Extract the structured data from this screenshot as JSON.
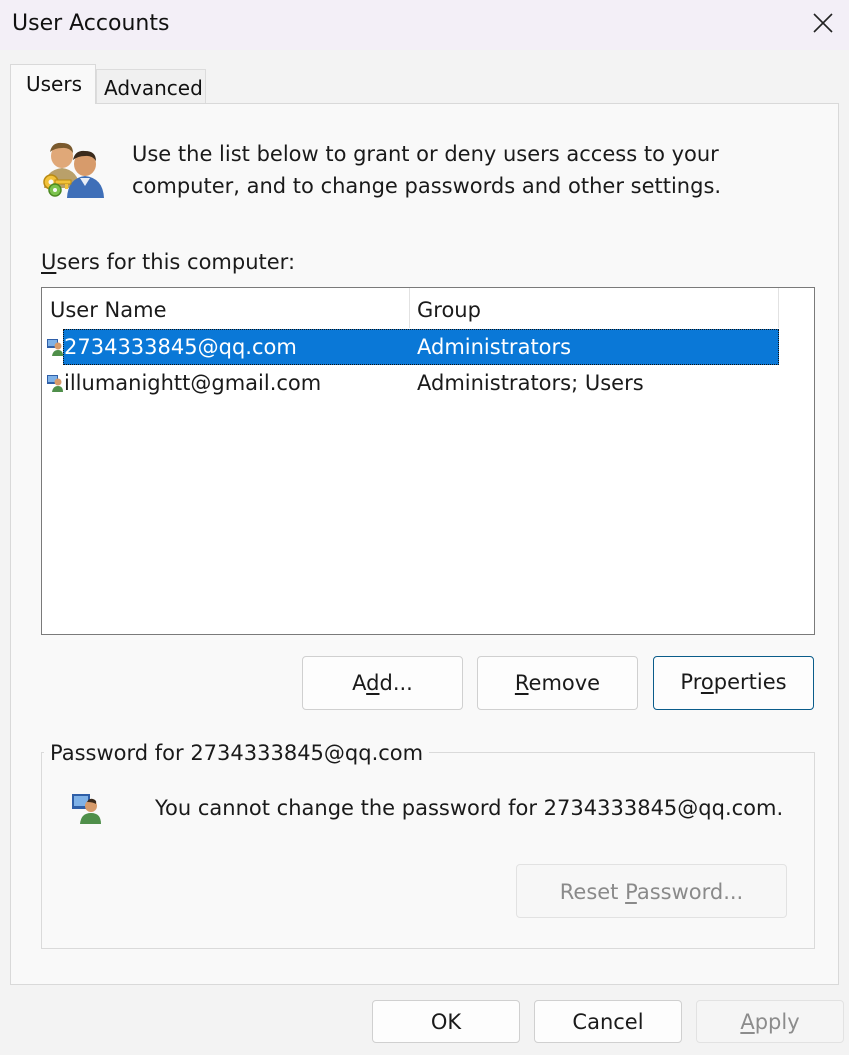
{
  "window": {
    "title": "User Accounts",
    "close_icon": "close-icon"
  },
  "tabs": [
    {
      "label": "Users",
      "active": true
    },
    {
      "label": "Advanced",
      "active": false
    }
  ],
  "intro": {
    "icon": "users-keys-icon",
    "text": "Use the list below to grant or deny users access to your computer, and to change passwords and other settings."
  },
  "users_list": {
    "label_accel": "U",
    "label_rest": "sers for this computer:",
    "columns": [
      "User Name",
      "Group"
    ],
    "rows": [
      {
        "name": "2734333845@qq.com",
        "group": "Administrators",
        "selected": true
      },
      {
        "name": "illumanightt@gmail.com",
        "group": "Administrators; Users",
        "selected": false
      }
    ]
  },
  "list_buttons": {
    "add": {
      "pre": "A",
      "accel": "d",
      "post": "d..."
    },
    "remove": {
      "pre": "",
      "accel": "R",
      "post": "emove"
    },
    "properties": {
      "pre": "Pr",
      "accel": "o",
      "post": "perties"
    }
  },
  "password_group": {
    "title": "Password for 2734333845@qq.com",
    "icon": "user-icon",
    "message": "You cannot change the password for 2734333845@qq.com.",
    "reset_button": {
      "pre": "Reset ",
      "accel": "P",
      "post": "assword...",
      "enabled": false
    }
  },
  "dialog_buttons": {
    "ok": "OK",
    "cancel": "Cancel",
    "apply": {
      "pre": "",
      "accel": "A",
      "post": "pply",
      "enabled": false
    }
  },
  "colors": {
    "selection": "#0a78d7",
    "properties_border": "#0a5c8a",
    "disabled_text": "#8a8a8a"
  }
}
